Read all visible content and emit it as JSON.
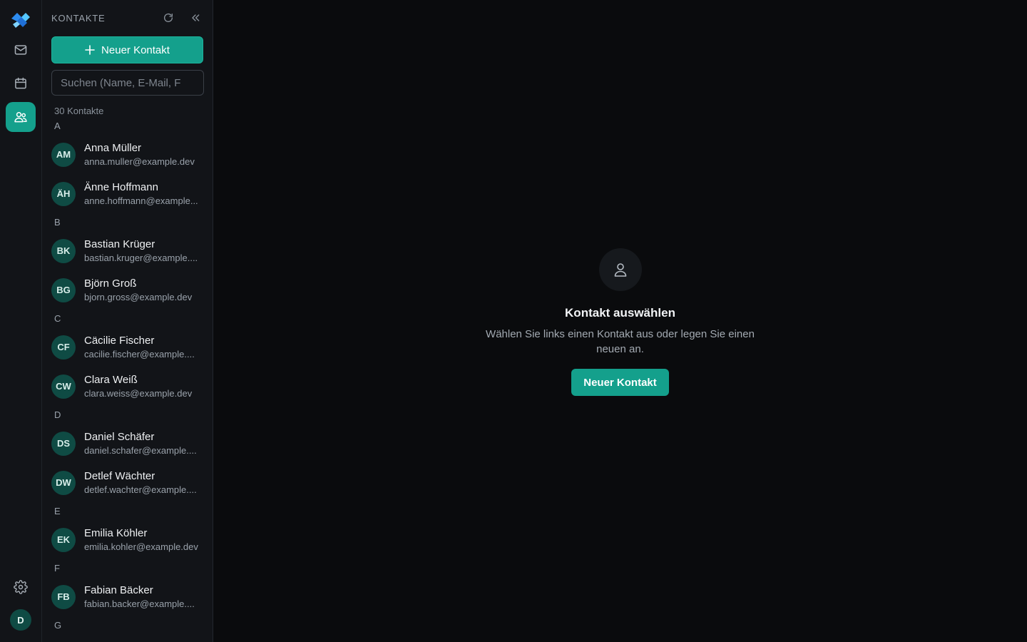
{
  "colors": {
    "accent": "#14a08c",
    "avatar": "#0f4b44",
    "background": "#0a0b0d",
    "panel": "#121418"
  },
  "rail": {
    "items": [
      {
        "icon": "mail-icon"
      },
      {
        "icon": "calendar-icon"
      },
      {
        "icon": "contacts-icon",
        "active": true
      }
    ],
    "settings_icon": "gear-icon",
    "user_initial": "D"
  },
  "panel": {
    "title": "KONTAKTE",
    "new_button_label": "Neuer Kontakt",
    "search_placeholder": "Suchen (Name, E-Mail, F",
    "count_label": "30 Kontakte",
    "groups": [
      {
        "letter": "A",
        "contacts": [
          {
            "initials": "AM",
            "name": "Anna Müller",
            "email": "anna.muller@example.dev"
          },
          {
            "initials": "ÄH",
            "name": "Änne Hoffmann",
            "email": "anne.hoffmann@example..."
          }
        ]
      },
      {
        "letter": "B",
        "contacts": [
          {
            "initials": "BK",
            "name": "Bastian Krüger",
            "email": "bastian.kruger@example...."
          },
          {
            "initials": "BG",
            "name": "Björn Groß",
            "email": "bjorn.gross@example.dev"
          }
        ]
      },
      {
        "letter": "C",
        "contacts": [
          {
            "initials": "CF",
            "name": "Cäcilie Fischer",
            "email": "cacilie.fischer@example...."
          },
          {
            "initials": "CW",
            "name": "Clara Weiß",
            "email": "clara.weiss@example.dev"
          }
        ]
      },
      {
        "letter": "D",
        "contacts": [
          {
            "initials": "DS",
            "name": "Daniel Schäfer",
            "email": "daniel.schafer@example...."
          },
          {
            "initials": "DW",
            "name": "Detlef Wächter",
            "email": "detlef.wachter@example...."
          }
        ]
      },
      {
        "letter": "E",
        "contacts": [
          {
            "initials": "EK",
            "name": "Emilia Köhler",
            "email": "emilia.kohler@example.dev"
          }
        ]
      },
      {
        "letter": "F",
        "contacts": [
          {
            "initials": "FB",
            "name": "Fabian Bäcker",
            "email": "fabian.backer@example...."
          }
        ]
      },
      {
        "letter": "G",
        "contacts": []
      }
    ]
  },
  "main": {
    "empty_icon": "person-icon",
    "title": "Kontakt auswählen",
    "text": "Wählen Sie links einen Kontakt aus oder legen Sie einen neuen an.",
    "button_label": "Neuer Kontakt"
  }
}
